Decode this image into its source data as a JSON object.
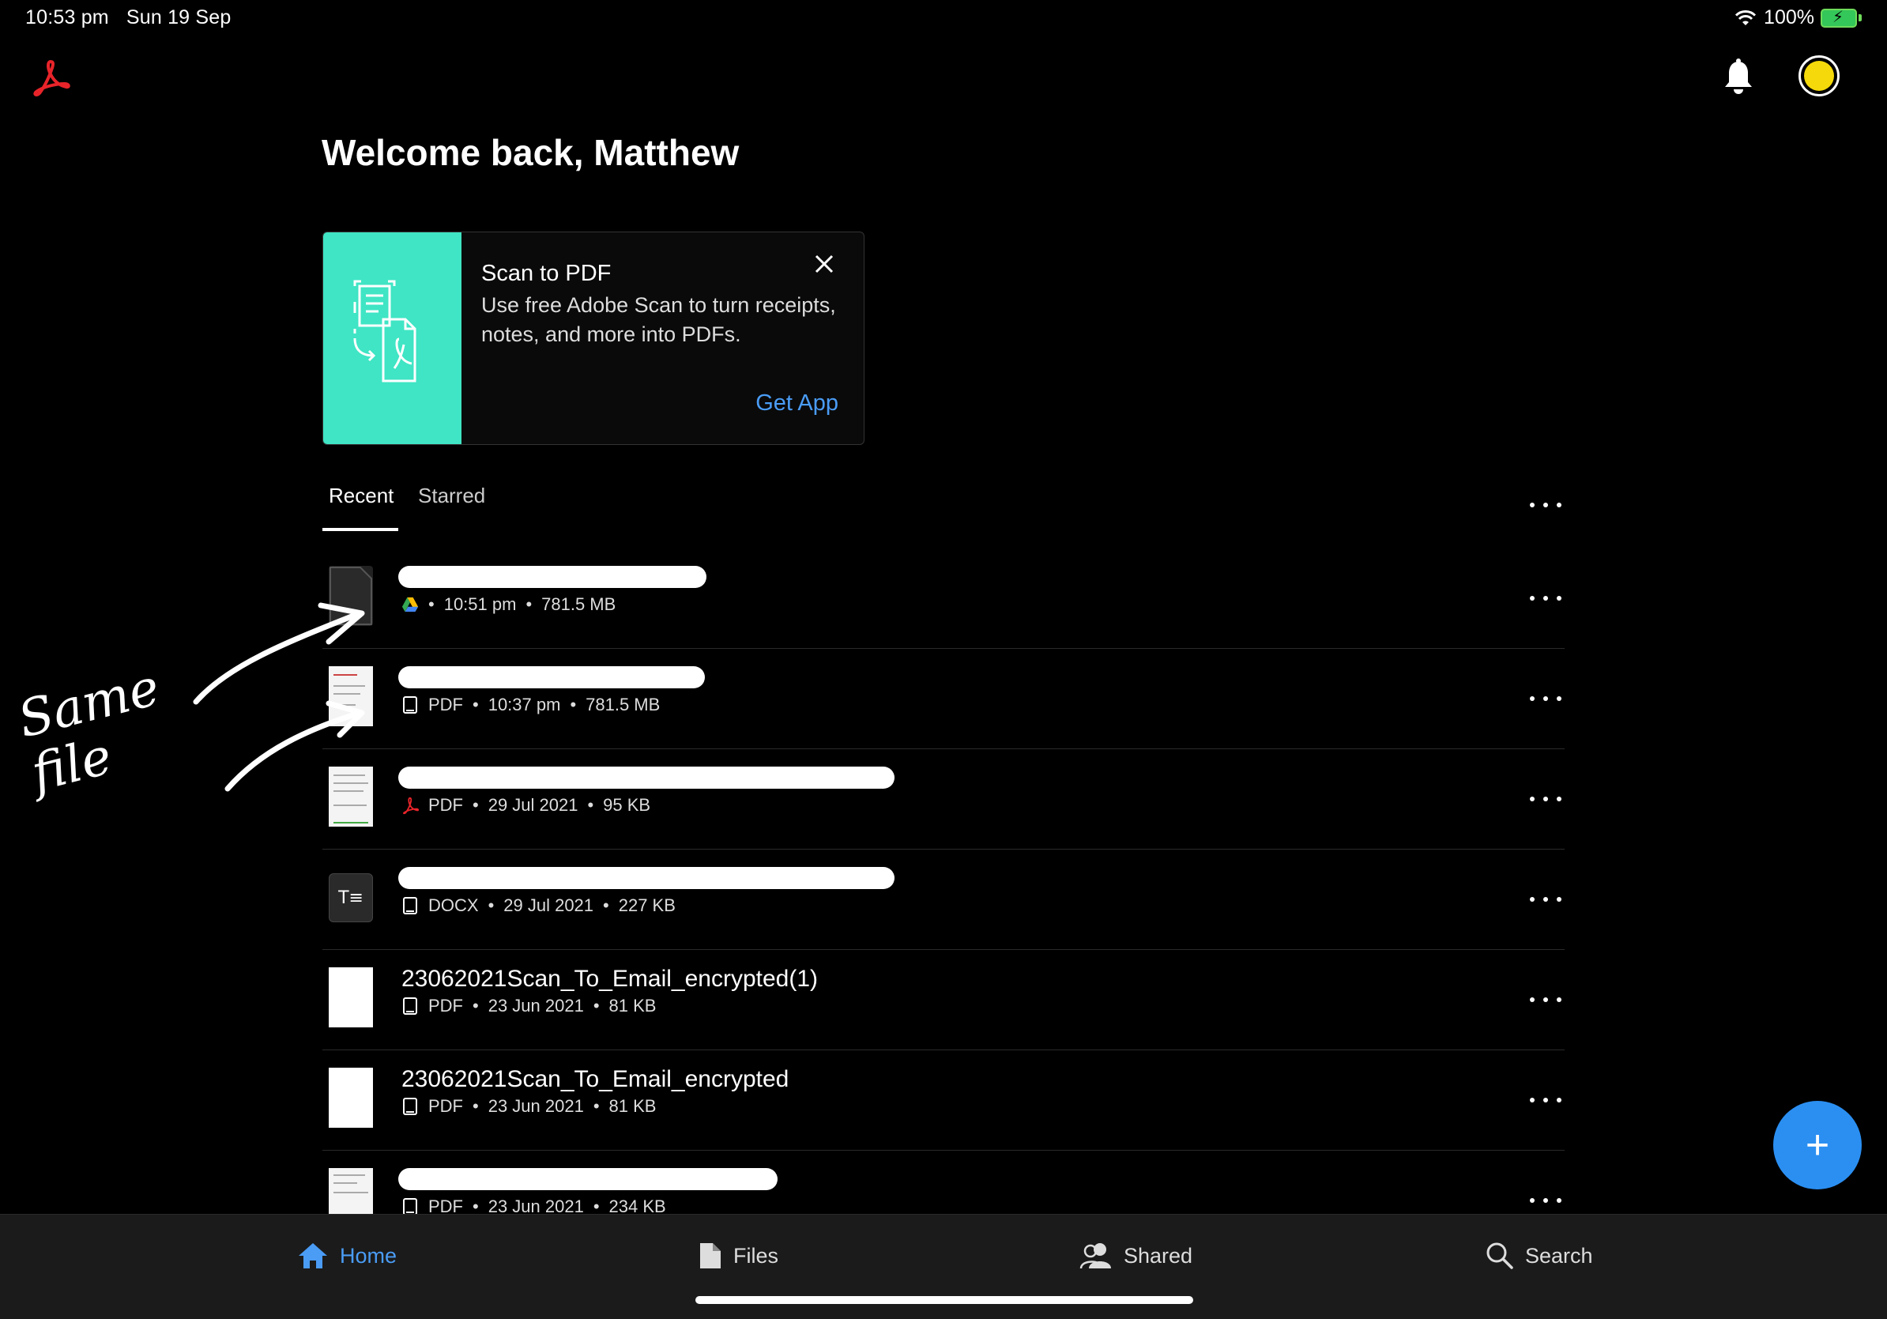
{
  "status": {
    "time": "10:53 pm",
    "date": "Sun 19 Sep",
    "battery": "100%"
  },
  "header": {
    "welcome": "Welcome back, Matthew"
  },
  "promo": {
    "title": "Scan to PDF",
    "description": "Use free Adobe Scan to turn receipts, notes, and more into PDFs.",
    "cta": "Get App"
  },
  "tabs": [
    {
      "label": "Recent",
      "active": true
    },
    {
      "label": "Starred",
      "active": false
    }
  ],
  "files": [
    {
      "name": "",
      "type": "",
      "time": "10:51 pm",
      "size": "781.5 MB",
      "source": "google-drive-icon"
    },
    {
      "name": "",
      "type": "PDF",
      "time": "10:37 pm",
      "size": "781.5 MB",
      "source": "device-icon"
    },
    {
      "name": "",
      "type": "PDF",
      "time": "29 Jul 2021",
      "size": "95 KB",
      "source": "acrobat-icon"
    },
    {
      "name": "",
      "type": "DOCX",
      "time": "29 Jul 2021",
      "size": "227 KB",
      "source": "device-icon"
    },
    {
      "name": "23062021Scan_To_Email_encrypted(1)",
      "type": "PDF",
      "time": "23 Jun 2021",
      "size": "81 KB",
      "source": "device-icon"
    },
    {
      "name": "23062021Scan_To_Email_encrypted",
      "type": "PDF",
      "time": "23 Jun 2021",
      "size": "81 KB",
      "source": "device-icon"
    },
    {
      "name": "",
      "type": "PDF",
      "time": "23 Jun 2021",
      "size": "234 KB",
      "source": "device-icon"
    }
  ],
  "annotation": {
    "text": "Same file"
  },
  "nav": [
    {
      "label": "Home",
      "icon": "home-icon",
      "active": true
    },
    {
      "label": "Files",
      "icon": "file-icon",
      "active": false
    },
    {
      "label": "Shared",
      "icon": "people-icon",
      "active": false
    },
    {
      "label": "Search",
      "icon": "search-icon",
      "active": false
    }
  ],
  "colors": {
    "accent": "#2b8ff2",
    "promo": "#3fe5c4",
    "acrobat": "#e8242a"
  },
  "fab": {
    "label": "+"
  }
}
